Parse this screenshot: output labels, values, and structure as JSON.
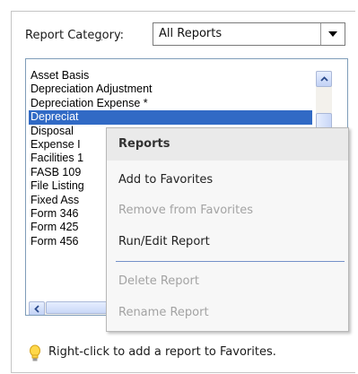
{
  "category": {
    "label_pre": "Report Cate",
    "label_underlined": "g",
    "label_post": "ory:",
    "selected": "All Reports"
  },
  "report_list": {
    "items": [
      "Asset Basis",
      "Depreciation Adjustment",
      "Depreciation Expense *",
      "Depreciat",
      "Disposal",
      "Expense I",
      "Facilities 1",
      "FASB 109",
      "File Listing",
      "Fixed Ass",
      "Form 346",
      "Form 425",
      "Form 456"
    ],
    "selected_index": 3
  },
  "context_menu": {
    "header": "Reports",
    "items": [
      {
        "label": "Add to Favorites",
        "enabled": true
      },
      {
        "label": "Remove from Favorites",
        "enabled": false
      },
      {
        "label": "Run/Edit Report",
        "enabled": true
      },
      {
        "label": "Delete Report",
        "enabled": false
      },
      {
        "label": "Rename Report",
        "enabled": false
      }
    ]
  },
  "hint": {
    "icon": "lightbulb-icon",
    "text": "Right-click to add a report to Favorites."
  },
  "colors": {
    "selection": "#316ac5",
    "menu_separator": "#7390c8",
    "disabled_text": "#a3a3a3"
  }
}
